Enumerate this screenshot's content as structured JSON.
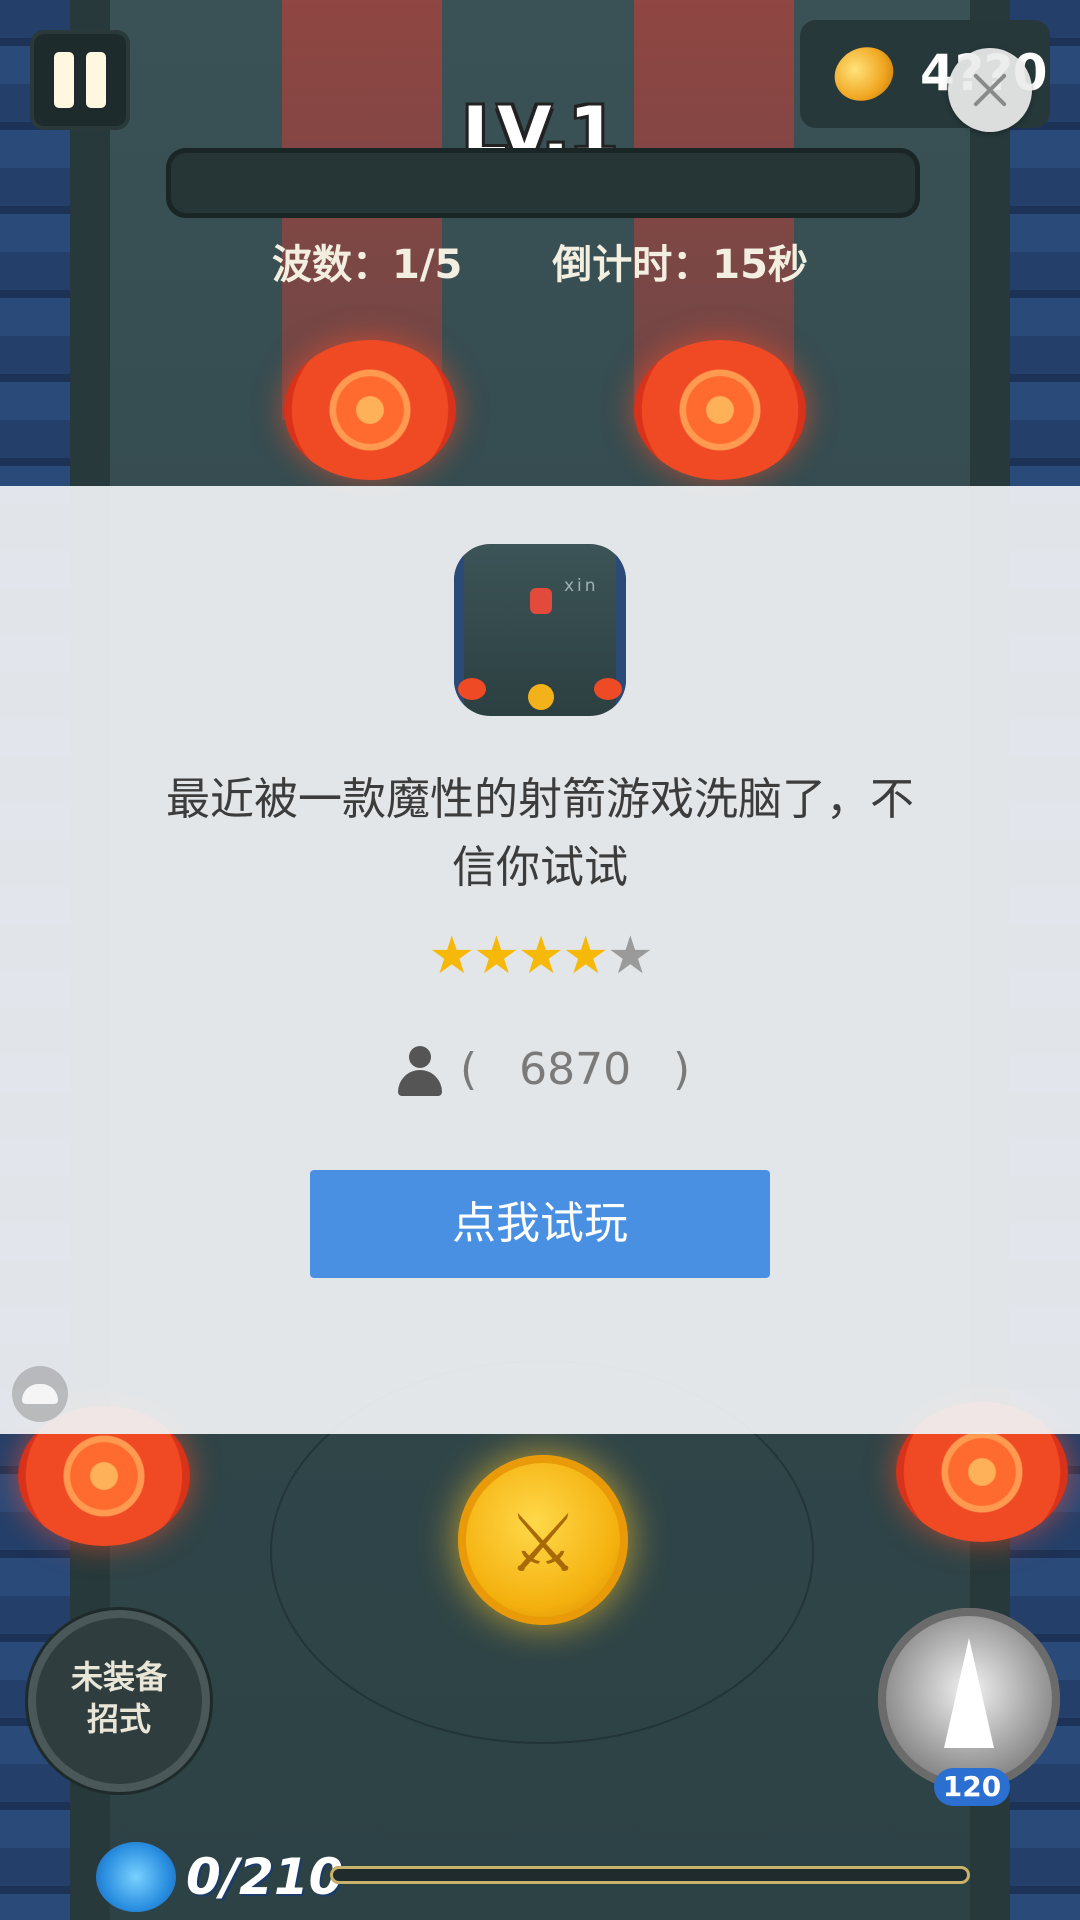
{
  "game": {
    "coins": "4??0",
    "level": "LV.1",
    "wave": "波数：1/5",
    "countdown": "倒计时：15秒",
    "skill_left": "未装备\n招式",
    "skill_right_cost": "120",
    "energy": "0/210"
  },
  "ad": {
    "title": "最近被一款魔性的射箭游戏洗脑了，不信你试试",
    "rating": 4,
    "rating_max": 5,
    "user_count_text": "(   6870   )",
    "icon_label": "xin",
    "cta_label": "点我试玩"
  },
  "colors": {
    "cta": "#4a90e2",
    "star_on": "#f6b90a",
    "star_off": "#9a9a9a"
  },
  "icons": [
    "pause-icon",
    "coin-icon",
    "close-icon",
    "attack-sword-icon",
    "crystal-skill-icon",
    "energy-icon",
    "user-icon",
    "turtle-icon"
  ]
}
